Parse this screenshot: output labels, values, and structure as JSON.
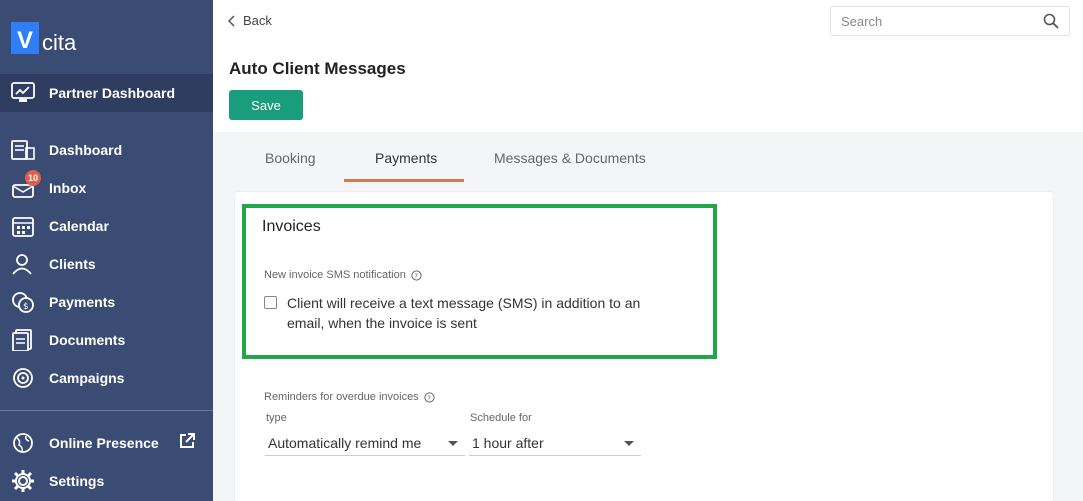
{
  "brand": {
    "logo_letter": "V",
    "logo_text": "cita",
    "color": "#2f7ef5"
  },
  "sidebar": {
    "partner_label": "Partner Dashboard",
    "items": [
      {
        "label": "Dashboard",
        "icon": "dashboard-icon"
      },
      {
        "label": "Inbox",
        "icon": "inbox-icon",
        "badge": "10"
      },
      {
        "label": "Calendar",
        "icon": "calendar-icon"
      },
      {
        "label": "Clients",
        "icon": "clients-icon"
      },
      {
        "label": "Payments",
        "icon": "payments-icon"
      },
      {
        "label": "Documents",
        "icon": "documents-icon"
      },
      {
        "label": "Campaigns",
        "icon": "campaigns-icon"
      }
    ],
    "bottom": [
      {
        "label": "Online Presence",
        "icon": "globe-icon"
      },
      {
        "label": "Settings",
        "icon": "gear-icon"
      }
    ]
  },
  "topbar": {
    "back_label": "Back",
    "search_placeholder": "Search"
  },
  "header": {
    "title": "Auto Client Messages",
    "save_label": "Save"
  },
  "tabs": [
    {
      "label": "Booking",
      "active": false
    },
    {
      "label": "Payments",
      "active": true
    },
    {
      "label": "Messages & Documents",
      "active": false
    }
  ],
  "invoices": {
    "title": "Invoices",
    "sms_label": "New invoice SMS notification",
    "sms_checkbox_text": "Client will receive a text message (SMS) in addition to an email, when the invoice is sent",
    "sms_checked": false
  },
  "reminders": {
    "label": "Reminders for overdue invoices",
    "type_label": "type",
    "type_value": "Automatically remind me",
    "schedule_label": "Schedule for",
    "schedule_value": "1 hour after"
  },
  "colors": {
    "sidebar": "#3a4c73",
    "accent_green": "#1a9d7c",
    "tab_underline": "#d27c4e",
    "highlight": "#21a64a"
  }
}
